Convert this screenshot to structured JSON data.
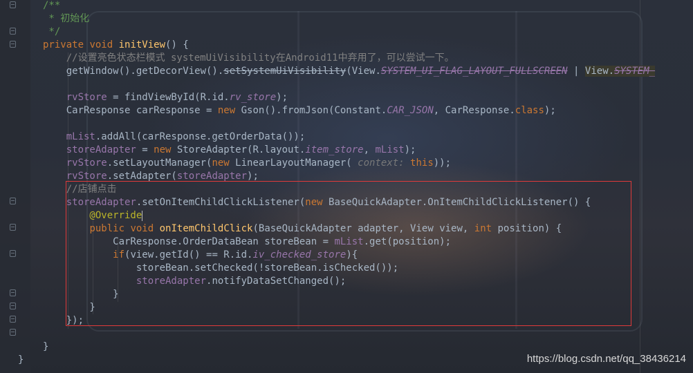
{
  "editor": {
    "lines": [
      {
        "id": "l1",
        "segs": [
          {
            "t": "/**",
            "c": "doc"
          }
        ]
      },
      {
        "id": "l2",
        "segs": [
          {
            "t": " * 初始化",
            "c": "doc"
          }
        ]
      },
      {
        "id": "l3",
        "segs": [
          {
            "t": " */",
            "c": "doc"
          }
        ]
      },
      {
        "id": "l4",
        "segs": [
          {
            "t": "private ",
            "c": "kw"
          },
          {
            "t": "void ",
            "c": "kw"
          },
          {
            "t": "initView",
            "c": "fn"
          },
          {
            "t": "() {",
            "c": ""
          }
        ]
      },
      {
        "id": "l5",
        "segs": [
          {
            "t": "    //设置亮色状态栏模式 systemUiVisibility在Android11中弃用了，可以尝试一下。",
            "c": "cmt"
          }
        ]
      },
      {
        "id": "l6",
        "segs": [
          {
            "t": "    getWindow().getDecorView().",
            "c": ""
          },
          {
            "t": "setSystemUiVisibility",
            "c": "strike"
          },
          {
            "t": "(View.",
            "c": ""
          },
          {
            "t": "SYSTEM_UI_FLAG_LAYOUT_FULLSCREEN",
            "c": "fld ital strike"
          },
          {
            "t": " | ",
            "c": ""
          },
          {
            "t": "View.",
            "c": "hl"
          },
          {
            "t": "SYSTEM_",
            "c": "fld ital strike hl"
          }
        ]
      },
      {
        "id": "l7",
        "segs": [
          {
            "t": "",
            "c": ""
          }
        ]
      },
      {
        "id": "l8",
        "segs": [
          {
            "t": "    rvStore",
            "c": "fld"
          },
          {
            "t": " = findViewById(R.id.",
            "c": ""
          },
          {
            "t": "rv_store",
            "c": "fld ital"
          },
          {
            "t": ");",
            "c": ""
          }
        ]
      },
      {
        "id": "l9",
        "segs": [
          {
            "t": "    CarResponse carResponse = ",
            "c": ""
          },
          {
            "t": "new ",
            "c": "kw"
          },
          {
            "t": "Gson().fromJson(Constant.",
            "c": ""
          },
          {
            "t": "CAR_JSON",
            "c": "fld ital"
          },
          {
            "t": ", CarResponse.",
            "c": ""
          },
          {
            "t": "class",
            "c": "kw"
          },
          {
            "t": ");",
            "c": ""
          }
        ]
      },
      {
        "id": "l10",
        "segs": [
          {
            "t": "",
            "c": ""
          }
        ]
      },
      {
        "id": "l11",
        "segs": [
          {
            "t": "    mList",
            "c": "fld"
          },
          {
            "t": ".addAll(carResponse.getOrderData());",
            "c": ""
          }
        ]
      },
      {
        "id": "l12",
        "segs": [
          {
            "t": "    storeAdapter",
            "c": "fld"
          },
          {
            "t": " = ",
            "c": ""
          },
          {
            "t": "new ",
            "c": "kw"
          },
          {
            "t": "StoreAdapter(R.layout.",
            "c": ""
          },
          {
            "t": "item_store",
            "c": "fld ital"
          },
          {
            "t": ", ",
            "c": ""
          },
          {
            "t": "mList",
            "c": "fld"
          },
          {
            "t": ");",
            "c": ""
          }
        ]
      },
      {
        "id": "l13",
        "segs": [
          {
            "t": "    rvStore",
            "c": "fld"
          },
          {
            "t": ".setLayoutManager(",
            "c": ""
          },
          {
            "t": "new ",
            "c": "kw"
          },
          {
            "t": "LinearLayoutManager( ",
            "c": ""
          },
          {
            "t": "context: ",
            "c": "hint"
          },
          {
            "t": "this",
            "c": "kw"
          },
          {
            "t": "));",
            "c": ""
          }
        ]
      },
      {
        "id": "l14",
        "segs": [
          {
            "t": "    rvStore",
            "c": "fld"
          },
          {
            "t": ".setAdapter(",
            "c": ""
          },
          {
            "t": "storeAdapter",
            "c": "fld"
          },
          {
            "t": ");",
            "c": ""
          }
        ]
      },
      {
        "id": "l15",
        "segs": [
          {
            "t": "    //店铺点击",
            "c": "cmt"
          }
        ]
      },
      {
        "id": "l16",
        "segs": [
          {
            "t": "    storeAdapter",
            "c": "fld"
          },
          {
            "t": ".setOnItemChildClickListener(",
            "c": ""
          },
          {
            "t": "new ",
            "c": "kw"
          },
          {
            "t": "BaseQuickAdapter.OnItemChildClickListener() {",
            "c": ""
          }
        ]
      },
      {
        "id": "l17",
        "segs": [
          {
            "t": "        @Override",
            "c": "ann"
          }
        ],
        "caret": true
      },
      {
        "id": "l18",
        "segs": [
          {
            "t": "        ",
            "c": ""
          },
          {
            "t": "public ",
            "c": "kw"
          },
          {
            "t": "void ",
            "c": "kw"
          },
          {
            "t": "onItemChildClick",
            "c": "fn"
          },
          {
            "t": "(BaseQuickAdapter adapter, View view, ",
            "c": ""
          },
          {
            "t": "int ",
            "c": "kw"
          },
          {
            "t": "position) {",
            "c": ""
          }
        ]
      },
      {
        "id": "l19",
        "segs": [
          {
            "t": "            CarResponse.OrderDataBean storeBean = ",
            "c": ""
          },
          {
            "t": "mList",
            "c": "fld"
          },
          {
            "t": ".get(position);",
            "c": ""
          }
        ]
      },
      {
        "id": "l20",
        "segs": [
          {
            "t": "            ",
            "c": ""
          },
          {
            "t": "if",
            "c": "kw"
          },
          {
            "t": "(view.getId() == R.id.",
            "c": ""
          },
          {
            "t": "iv_checked_store",
            "c": "fld ital"
          },
          {
            "t": "){",
            "c": ""
          }
        ]
      },
      {
        "id": "l21",
        "segs": [
          {
            "t": "                storeBean.setChecked(!storeBean.isChecked());",
            "c": ""
          }
        ]
      },
      {
        "id": "l22",
        "segs": [
          {
            "t": "                storeAdapter",
            "c": "fld"
          },
          {
            "t": ".notifyDataSetChanged();",
            "c": ""
          }
        ]
      },
      {
        "id": "l23",
        "segs": [
          {
            "t": "            }",
            "c": ""
          }
        ]
      },
      {
        "id": "l24",
        "segs": [
          {
            "t": "        }",
            "c": ""
          }
        ]
      },
      {
        "id": "l25",
        "segs": [
          {
            "t": "    });",
            "c": ""
          }
        ]
      },
      {
        "id": "l26",
        "segs": [
          {
            "t": "",
            "c": ""
          }
        ]
      },
      {
        "id": "l27",
        "segs": [
          {
            "t": "}",
            "c": ""
          }
        ]
      },
      {
        "id": "l28",
        "segs": [
          {
            "t": "}",
            "c": ""
          }
        ]
      }
    ]
  },
  "watermark": "https://blog.csdn.net/qq_38436214"
}
